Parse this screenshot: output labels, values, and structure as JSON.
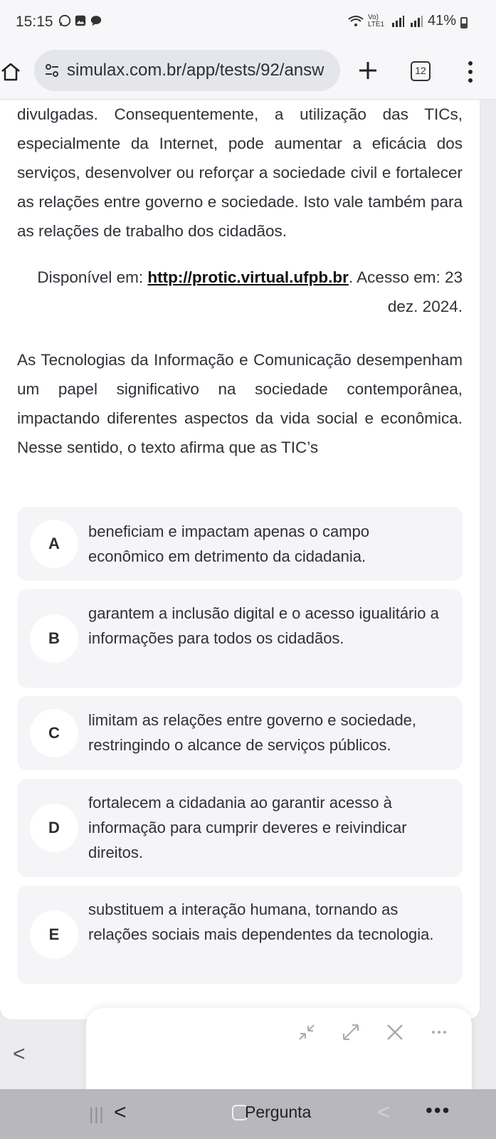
{
  "status_bar": {
    "time": "15:15",
    "network_label": "Vo) LTE1",
    "battery": "41%"
  },
  "browser": {
    "url": "simulax.com.br/app/tests/92/answ",
    "tab_count": "12"
  },
  "content": {
    "paragraph1": "divulgadas. Consequentemente, a utilização das TICs, especialmente da Internet, pode aumentar a eficácia dos serviços, desenvolver ou reforçar a sociedade civil e fortalecer as relações entre governo e sociedade. Isto vale também para as relações de trabalho dos cidadãos.",
    "source_prefix": "Disponível em: ",
    "source_link": "http://protic.virtual.ufpb.br",
    "source_suffix": ". Acesso em: 23 dez. 2024.",
    "question": "As Tecnologias da Informação e Comunicação desempenham um papel significativo na sociedade contemporânea, impactando diferentes aspectos da vida social e econômica. Nesse sentido, o texto afirma que as TIC’s"
  },
  "options": [
    {
      "letter": "A",
      "text": "beneficiam e impactam apenas o campo econômico em detrimento da cidadania."
    },
    {
      "letter": "B",
      "text": "garantem a inclusão digital e o acesso igualitário a informações para todos os cidadãos."
    },
    {
      "letter": "C",
      "text": "limitam as relações entre governo e sociedade, restringindo o alcance de serviços públicos."
    },
    {
      "letter": "D",
      "text": "fortalecem a cidadania ao garantir acesso à informação para cumprir deveres e reivindicar direitos."
    },
    {
      "letter": "E",
      "text": "substituem a interação humana, tornando as relações sociais mais dependentes da tecnologia."
    }
  ],
  "bottom_panel": {
    "back": "<",
    "nav_label": "Pergunta",
    "more": "•••"
  }
}
